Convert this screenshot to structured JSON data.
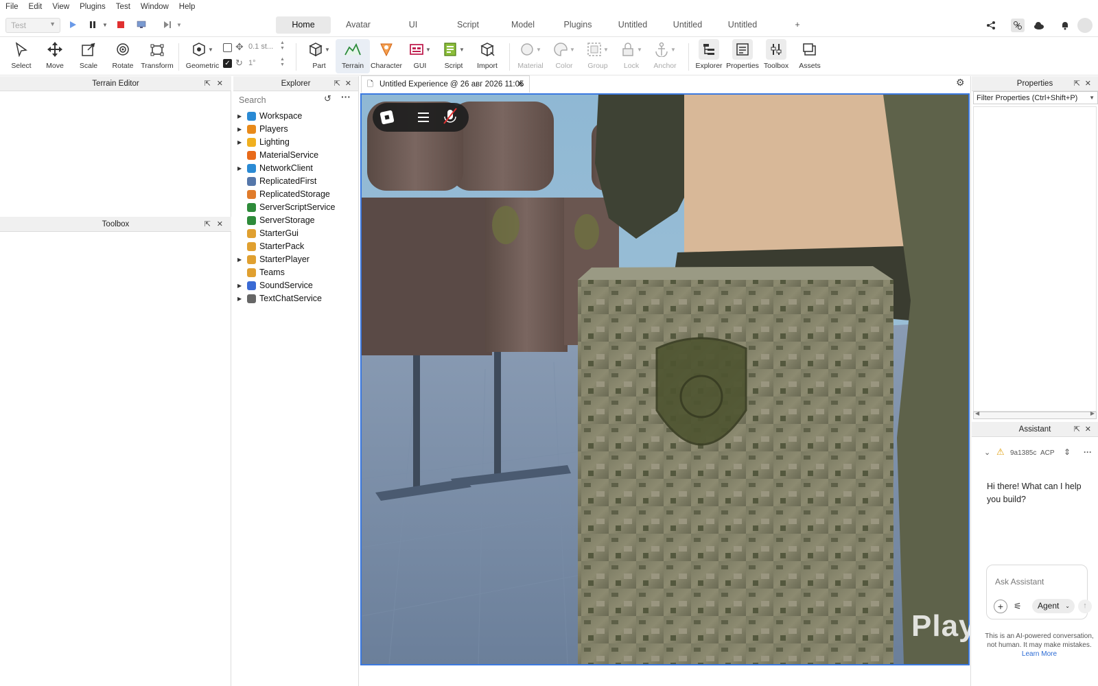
{
  "menu": [
    "File",
    "Edit",
    "View",
    "Plugins",
    "Test",
    "Window",
    "Help"
  ],
  "test_select": {
    "value": "Test"
  },
  "ribbon_tabs": [
    "Home",
    "Avatar",
    "UI",
    "Script",
    "Model",
    "Plugins",
    "Untitled",
    "Untitled",
    "Untitled",
    "+"
  ],
  "tools": {
    "select": "Select",
    "move": "Move",
    "scale": "Scale",
    "rotate": "Rotate",
    "transform": "Transform",
    "geometric": "Geometric",
    "snap_move": "0.1 st...",
    "snap_rotate": "1°",
    "part": "Part",
    "terrain": "Terrain",
    "character": "Character",
    "gui": "GUI",
    "script": "Script",
    "import": "Import",
    "material": "Material",
    "color": "Color",
    "group": "Group",
    "lock": "Lock",
    "anchor": "Anchor",
    "explorer": "Explorer",
    "properties": "Properties",
    "toolbox": "Toolbox",
    "assets": "Assets"
  },
  "panels": {
    "terrain_editor": "Terrain Editor",
    "toolbox": "Toolbox",
    "explorer": "Explorer",
    "properties": "Properties",
    "assistant": "Assistant"
  },
  "explorer": {
    "search_placeholder": "Search",
    "items": [
      {
        "name": "Workspace",
        "expandable": true,
        "icon": "globe-icon",
        "color": "#2a8ad4"
      },
      {
        "name": "Players",
        "expandable": true,
        "icon": "players-icon",
        "color": "#e88a1a"
      },
      {
        "name": "Lighting",
        "expandable": true,
        "icon": "bulb-icon",
        "color": "#f0b020"
      },
      {
        "name": "MaterialService",
        "expandable": false,
        "icon": "material-icon",
        "color": "#e86a1a"
      },
      {
        "name": "NetworkClient",
        "expandable": true,
        "icon": "network-icon",
        "color": "#2a8ad4"
      },
      {
        "name": "ReplicatedFirst",
        "expandable": false,
        "icon": "replicated-icon",
        "color": "#5577aa"
      },
      {
        "name": "ReplicatedStorage",
        "expandable": false,
        "icon": "storage-icon",
        "color": "#e07b2a"
      },
      {
        "name": "ServerScriptService",
        "expandable": false,
        "icon": "server-script-icon",
        "color": "#2e8b3a"
      },
      {
        "name": "ServerStorage",
        "expandable": false,
        "icon": "server-storage-icon",
        "color": "#2e8b3a"
      },
      {
        "name": "StarterGui",
        "expandable": false,
        "icon": "starter-gui-icon",
        "color": "#e0a030"
      },
      {
        "name": "StarterPack",
        "expandable": false,
        "icon": "starter-pack-icon",
        "color": "#e0a030"
      },
      {
        "name": "StarterPlayer",
        "expandable": true,
        "icon": "starter-player-icon",
        "color": "#e0a030"
      },
      {
        "name": "Teams",
        "expandable": false,
        "icon": "teams-icon",
        "color": "#e0a030"
      },
      {
        "name": "SoundService",
        "expandable": true,
        "icon": "sound-icon",
        "color": "#3a6ad4"
      },
      {
        "name": "TextChatService",
        "expandable": true,
        "icon": "chat-icon",
        "color": "#666"
      }
    ]
  },
  "viewport": {
    "tab_label": "Untitled Experience @ 26 авг 2026 11:05"
  },
  "properties": {
    "filter_placeholder": "Filter Properties (Ctrl+Shift+P)"
  },
  "assistant": {
    "session_id": "9a1385c",
    "mode_label": "ACP",
    "message": "Hi there! What can I help you build?",
    "input_placeholder": "Ask Assistant",
    "agent_label": "Agent",
    "disclaimer": "This is an AI-powered conversation, not human. It may make mistakes.",
    "learn_more": "Learn More"
  },
  "watermark": "Playerok",
  "colors": {
    "accent": "#3a78e0",
    "stop": "#e03030"
  }
}
